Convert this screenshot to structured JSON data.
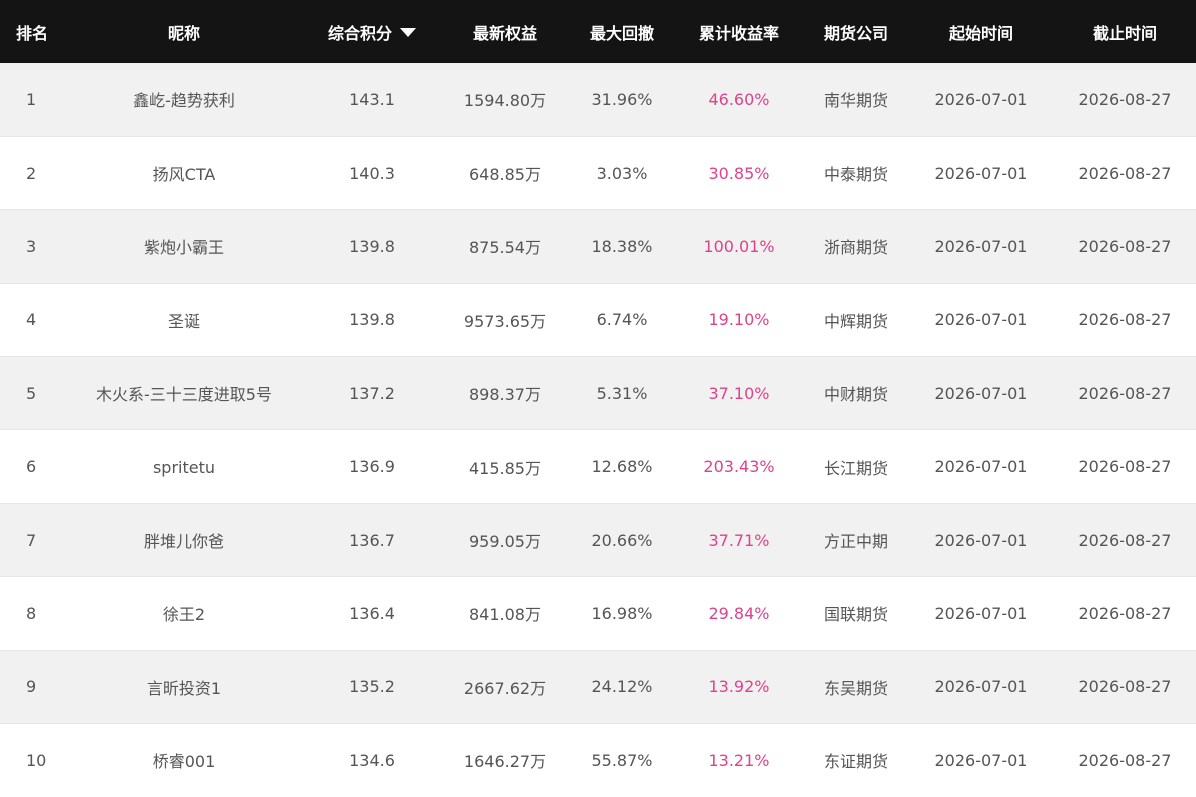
{
  "colors": {
    "header_bg": "#141414",
    "header_text": "#ffffff",
    "row_alt_bg": "#f1f1f1",
    "text": "#555555",
    "return_accent": "#e0428a"
  },
  "table": {
    "headers": {
      "rank": "排名",
      "nickname": "昵称",
      "score": "综合积分",
      "equity": "最新权益",
      "drawdown": "最大回撤",
      "return": "累计收益率",
      "broker": "期货公司",
      "start": "起始时间",
      "end": "截止时间"
    },
    "sort": {
      "column": "score",
      "direction": "desc",
      "icon": "caret-down-icon"
    },
    "rows": [
      {
        "rank": "1",
        "nickname": "鑫屹-趋势获利",
        "score": "143.1",
        "equity": "1594.80万",
        "drawdown": "31.96%",
        "return": "46.60%",
        "broker": "南华期货",
        "start": "2026-07-01",
        "end": "2026-08-27"
      },
      {
        "rank": "2",
        "nickname": "扬风CTA",
        "score": "140.3",
        "equity": "648.85万",
        "drawdown": "3.03%",
        "return": "30.85%",
        "broker": "中泰期货",
        "start": "2026-07-01",
        "end": "2026-08-27"
      },
      {
        "rank": "3",
        "nickname": "紫炮小霸王",
        "score": "139.8",
        "equity": "875.54万",
        "drawdown": "18.38%",
        "return": "100.01%",
        "broker": "浙商期货",
        "start": "2026-07-01",
        "end": "2026-08-27"
      },
      {
        "rank": "4",
        "nickname": "圣诞",
        "score": "139.8",
        "equity": "9573.65万",
        "drawdown": "6.74%",
        "return": "19.10%",
        "broker": "中辉期货",
        "start": "2026-07-01",
        "end": "2026-08-27"
      },
      {
        "rank": "5",
        "nickname": "木火系-三十三度进取5号",
        "score": "137.2",
        "equity": "898.37万",
        "drawdown": "5.31%",
        "return": "37.10%",
        "broker": "中财期货",
        "start": "2026-07-01",
        "end": "2026-08-27"
      },
      {
        "rank": "6",
        "nickname": "spritetu",
        "score": "136.9",
        "equity": "415.85万",
        "drawdown": "12.68%",
        "return": "203.43%",
        "broker": "长江期货",
        "start": "2026-07-01",
        "end": "2026-08-27"
      },
      {
        "rank": "7",
        "nickname": "胖堆儿你爸",
        "score": "136.7",
        "equity": "959.05万",
        "drawdown": "20.66%",
        "return": "37.71%",
        "broker": "方正中期",
        "start": "2026-07-01",
        "end": "2026-08-27"
      },
      {
        "rank": "8",
        "nickname": "徐王2",
        "score": "136.4",
        "equity": "841.08万",
        "drawdown": "16.98%",
        "return": "29.84%",
        "broker": "国联期货",
        "start": "2026-07-01",
        "end": "2026-08-27"
      },
      {
        "rank": "9",
        "nickname": "言昕投资1",
        "score": "135.2",
        "equity": "2667.62万",
        "drawdown": "24.12%",
        "return": "13.92%",
        "broker": "东吴期货",
        "start": "2026-07-01",
        "end": "2026-08-27"
      },
      {
        "rank": "10",
        "nickname": "桥睿001",
        "score": "134.6",
        "equity": "1646.27万",
        "drawdown": "55.87%",
        "return": "13.21%",
        "broker": "东证期货",
        "start": "2026-07-01",
        "end": "2026-08-27"
      }
    ]
  }
}
